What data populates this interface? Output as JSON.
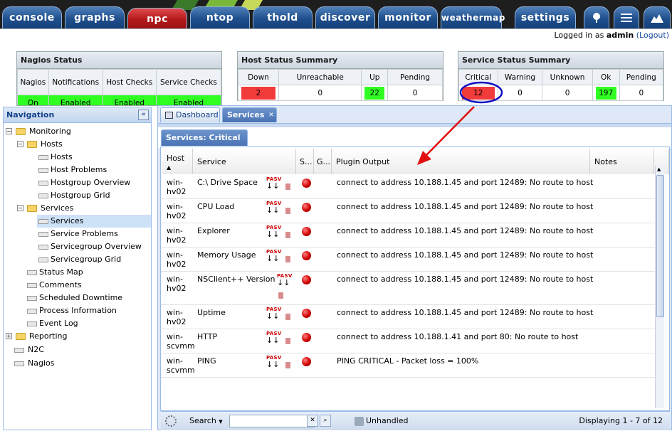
{
  "nav_tabs": [
    "console",
    "graphs",
    "npc",
    "ntop",
    "thold",
    "discover",
    "monitor",
    "weathermap",
    "settings"
  ],
  "login": {
    "prefix": "Logged in as ",
    "user": "admin",
    "logout": "(Logout)"
  },
  "nagios_status": {
    "title": "Nagios Status",
    "headers": [
      "Nagios",
      "Notifications",
      "Host Checks",
      "Service Checks"
    ],
    "values": [
      "On",
      "Enabled",
      "Enabled",
      "Enabled"
    ]
  },
  "host_summary": {
    "title": "Host Status Summary",
    "headers": [
      "Down",
      "Unreachable",
      "Up",
      "Pending"
    ],
    "values": [
      "2",
      "0",
      "22",
      "0"
    ]
  },
  "service_summary": {
    "title": "Service Status Summary",
    "headers": [
      "Critical",
      "Warning",
      "Unknown",
      "Ok",
      "Pending"
    ],
    "values": [
      "12",
      "0",
      "0",
      "197",
      "0"
    ]
  },
  "navigation": {
    "title": "Navigation",
    "items": [
      "Monitoring",
      "Hosts",
      "Hosts",
      "Host Problems",
      "Hostgroup Overview",
      "Hostgroup Grid",
      "Services",
      "Services",
      "Service Problems",
      "Servicegroup Overview",
      "Servicegroup Grid",
      "Status Map",
      "Comments",
      "Scheduled Downtime",
      "Process Information",
      "Event Log",
      "Reporting",
      "N2C",
      "Nagios"
    ]
  },
  "main_tabs": [
    "Dashboard",
    "Services"
  ],
  "sub_tab": "Services: Critical",
  "grid": {
    "columns": [
      "Host",
      "Service",
      "S...",
      "G...",
      "Plugin Output",
      "Notes"
    ],
    "pasv": "PASV",
    "rows": [
      {
        "host": "win-hv02",
        "service": "C:\\ Drive Space",
        "output": "connect to address 10.188.1.45 and port 12489: No route to host"
      },
      {
        "host": "win-hv02",
        "service": "CPU Load",
        "output": "connect to address 10.188.1.45 and port 12489: No route to host"
      },
      {
        "host": "win-hv02",
        "service": "Explorer",
        "output": "connect to address 10.188.1.45 and port 12489: No route to host"
      },
      {
        "host": "win-hv02",
        "service": "Memory Usage",
        "output": "connect to address 10.188.1.45 and port 12489: No route to host"
      },
      {
        "host": "win-hv02",
        "service": "NSClient++ Version",
        "output": "connect to address 10.188.1.45 and port 12489: No route to host"
      },
      {
        "host": "win-hv02",
        "service": "Uptime",
        "output": "connect to address 10.188.1.45 and port 12489: No route to host"
      },
      {
        "host": "win-scvmm",
        "service": "HTTP",
        "output": "connect to address 10.188.1.41 and port 80: No route to host"
      },
      {
        "host": "win-scvmm",
        "service": "PING",
        "output": "PING CRITICAL - Packet loss = 100%"
      }
    ]
  },
  "toolbar": {
    "search": "Search",
    "unhandled": "Unhandled",
    "paging": "Displaying 1 - 7 of 12"
  },
  "colors": {
    "critical": "#f23b3b",
    "ok": "#30ff22",
    "tab_blue": "#1f4f8c",
    "tab_red": "#b21a1c",
    "annotation": "#e01010",
    "circle": "#1010c0"
  }
}
